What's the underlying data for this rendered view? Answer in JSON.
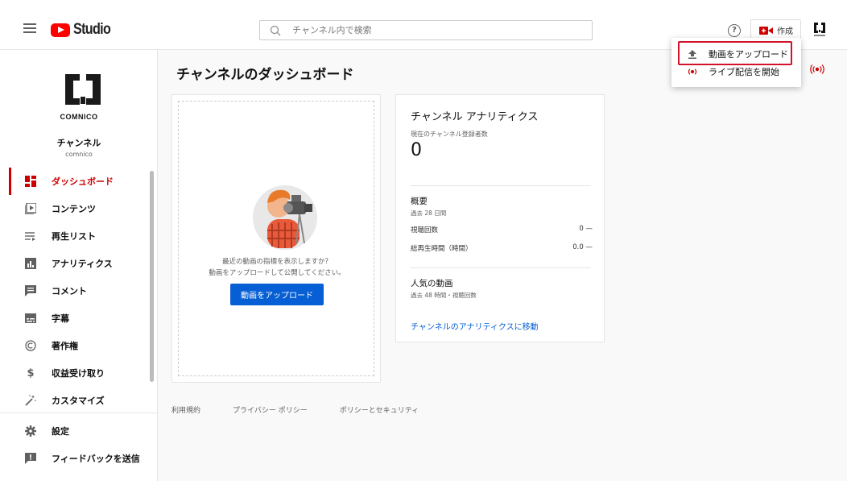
{
  "header": {
    "logo_text": "Studio",
    "search_placeholder": "チャンネル内で検索",
    "create_label": "作成"
  },
  "dropdown": {
    "items": [
      {
        "label": "動画をアップロード",
        "icon": "upload-icon"
      },
      {
        "label": "ライブ配信を開始",
        "icon": "live-icon"
      }
    ]
  },
  "sidebar": {
    "brand": "COMNICO",
    "channel_name": "チャンネル",
    "channel_handle": "comnico",
    "items": [
      {
        "label": "ダッシュボード",
        "icon": "dashboard-icon",
        "active": true
      },
      {
        "label": "コンテンツ",
        "icon": "content-icon"
      },
      {
        "label": "再生リスト",
        "icon": "playlist-icon"
      },
      {
        "label": "アナリティクス",
        "icon": "analytics-icon"
      },
      {
        "label": "コメント",
        "icon": "comment-icon"
      },
      {
        "label": "字幕",
        "icon": "subtitles-icon"
      },
      {
        "label": "著作権",
        "icon": "copyright-icon"
      },
      {
        "label": "収益受け取り",
        "icon": "monetization-icon"
      },
      {
        "label": "カスタマイズ",
        "icon": "customize-icon"
      },
      {
        "label": "設定",
        "icon": "settings-icon"
      },
      {
        "label": "フィードバックを送信",
        "icon": "feedback-icon"
      }
    ]
  },
  "main": {
    "title": "チャンネルのダッシュボード",
    "upload_card": {
      "text_line1": "最近の動画の指標を表示しますか？",
      "text_line2": "動画をアップロードして公開してください。",
      "button": "動画をアップロード"
    },
    "analytics_card": {
      "title": "チャンネル アナリティクス",
      "subscribers_label": "現在のチャンネル登録者数",
      "subscribers_value": "0",
      "summary_title": "概要",
      "summary_period": "過去 28 日間",
      "views_label": "視聴回数",
      "views_value": "0 —",
      "watch_label": "総再生時間（時間）",
      "watch_value": "0.0 —",
      "top_videos_title": "人気の動画",
      "top_videos_period": "過去 48 時間・視聴回数",
      "link": "チャンネルのアナリティクスに移動"
    }
  },
  "footer": {
    "links": [
      "利用規約",
      "プライバシー ポリシー",
      "ポリシーとセキュリティ"
    ]
  },
  "colors": {
    "accent": "#cc0000",
    "link": "#065fd4",
    "highlight_box": "#d0122a"
  }
}
